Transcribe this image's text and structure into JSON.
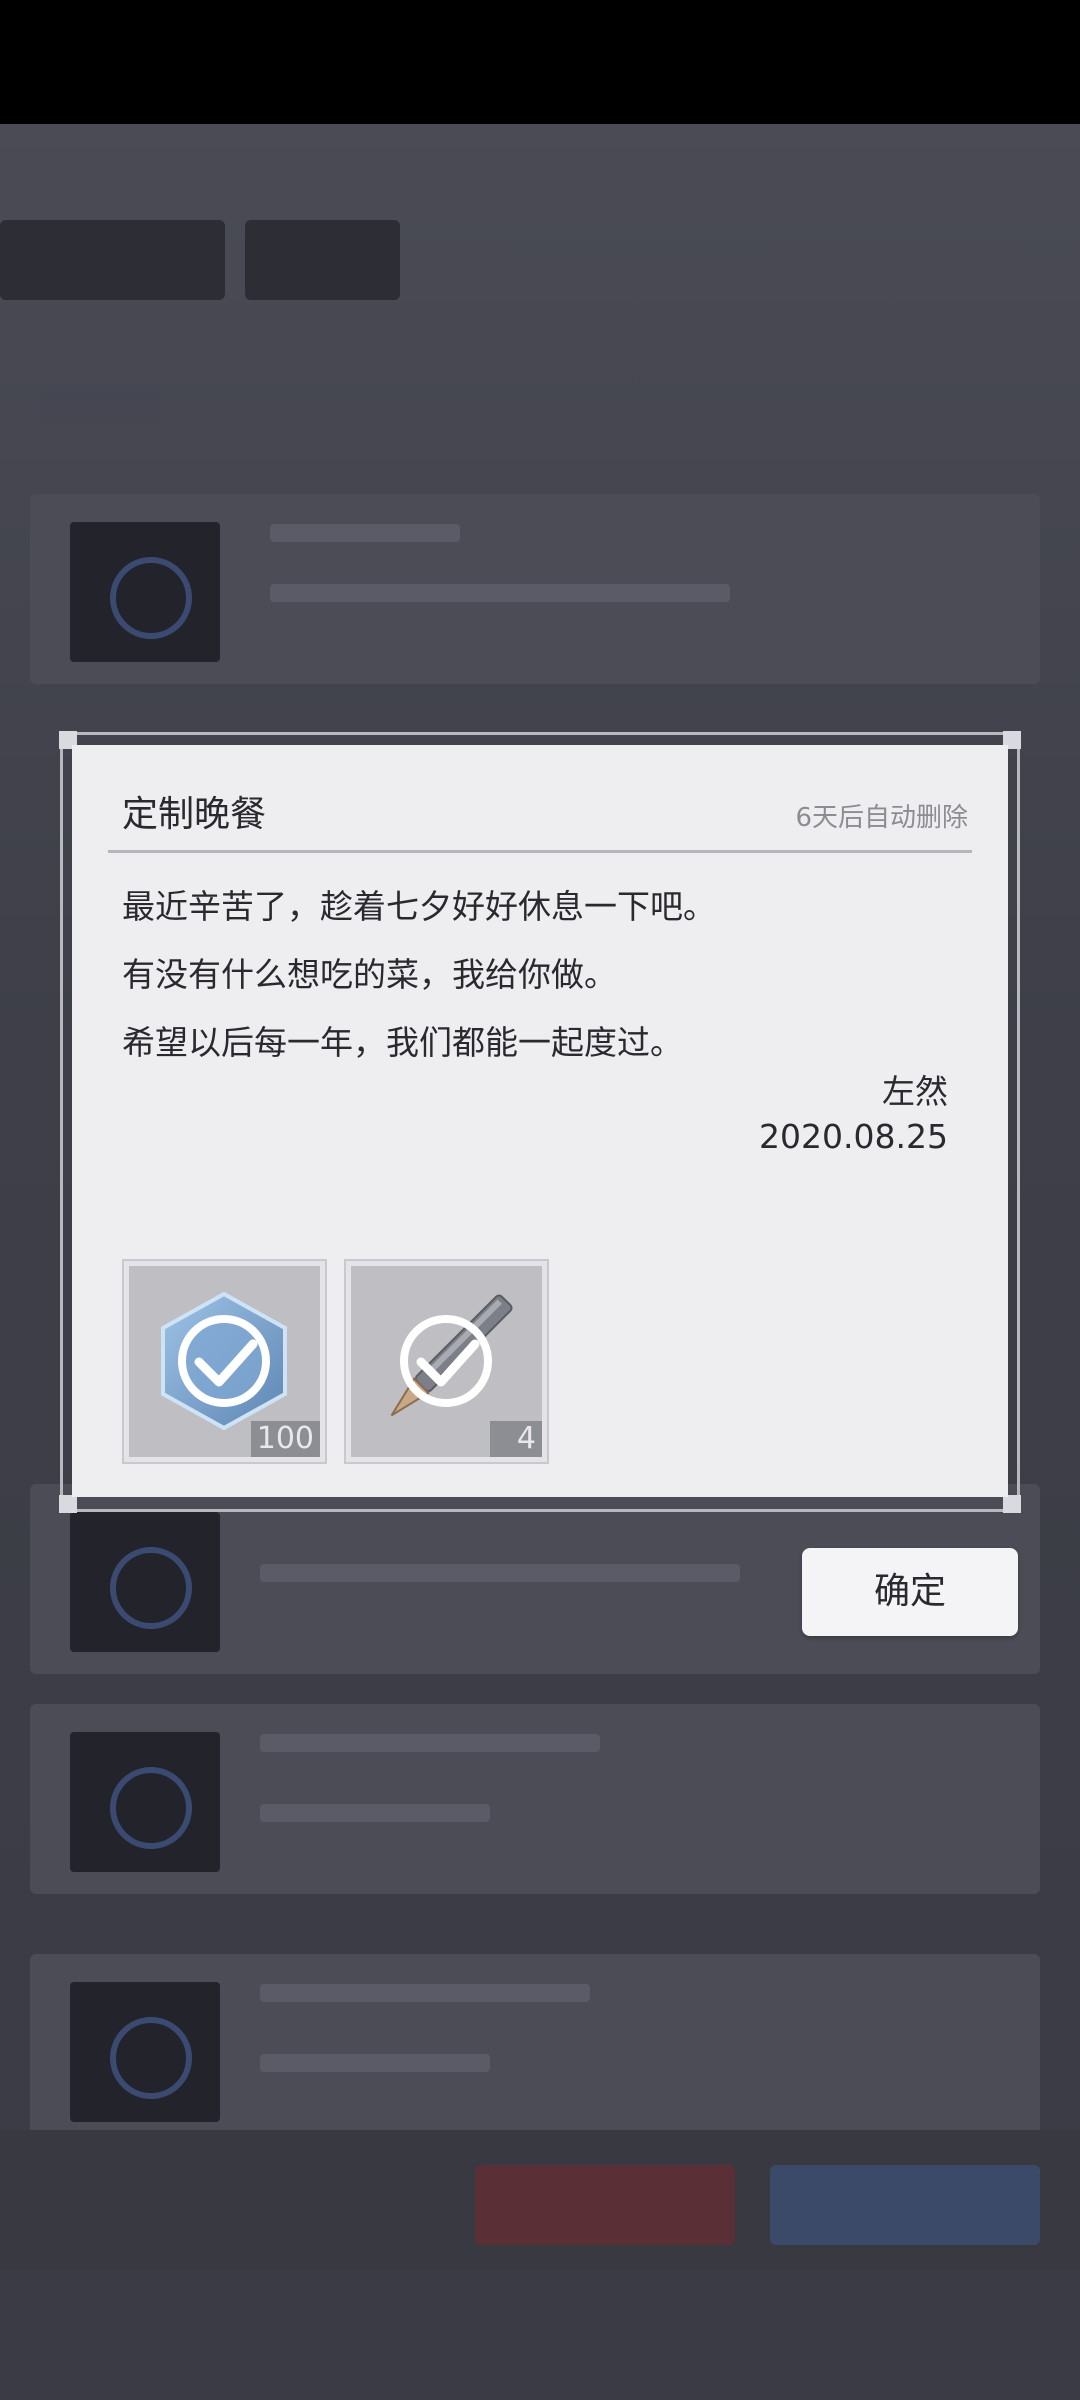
{
  "mail": {
    "title": "定制晚餐",
    "expire_text": "6天后自动删除",
    "body_lines": [
      "最近辛苦了，趁着七夕好好休息一下吧。",
      "有没有什么想吃的菜，我给你做。",
      "希望以后每一年，我们都能一起度过。"
    ],
    "signature": "左然",
    "date": "2020.08.25"
  },
  "rewards": [
    {
      "icon": "hexagon-badge-icon",
      "quantity": "100",
      "claimed": true
    },
    {
      "icon": "pen-icon",
      "quantity": "4",
      "claimed": true
    }
  ],
  "confirm_label": "确定",
  "colors": {
    "dialog_bg": "#eeeef1",
    "overlay_bg": "#3c3d45",
    "text": "#2a2a2e",
    "muted_text": "#8c8c92"
  }
}
